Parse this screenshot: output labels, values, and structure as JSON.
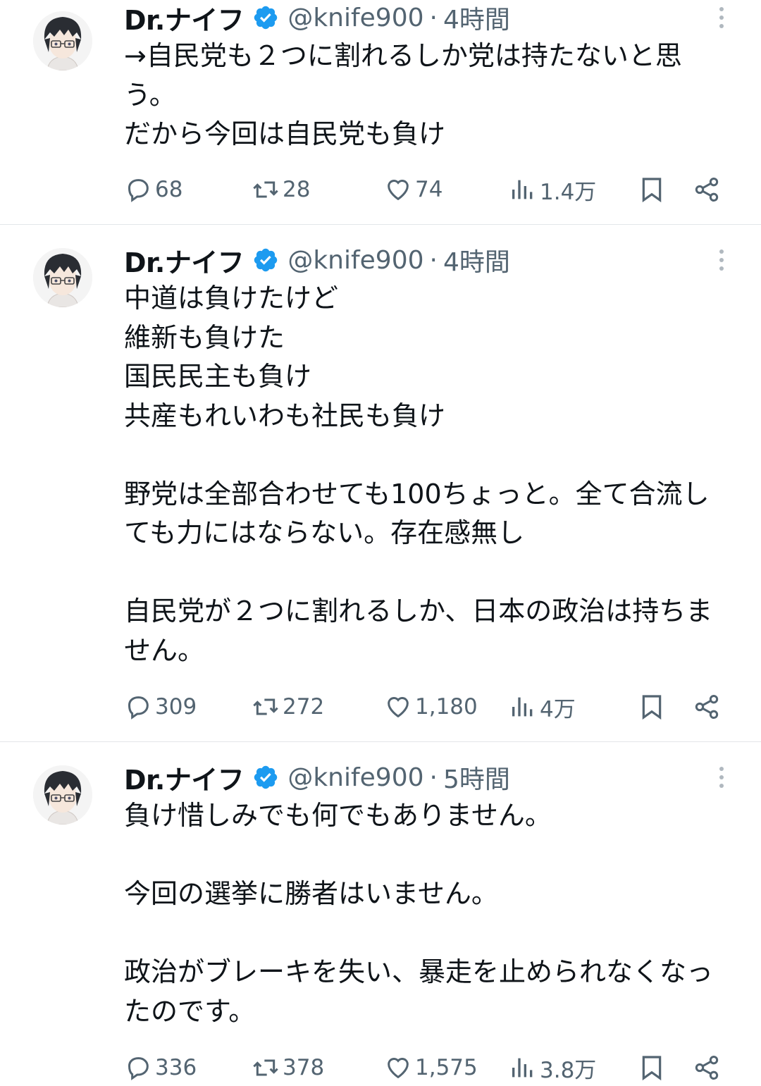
{
  "tweets": [
    {
      "author": {
        "name": "Dr.ナイフ",
        "handle": "@knife900",
        "verified": true
      },
      "time": "4時間",
      "text": "→自民党も２つに割れるしか党は持たないと思う。\nだから今回は自民党も負け",
      "stats": {
        "replies": "68",
        "reposts": "28",
        "likes": "74",
        "views": "1.4万"
      }
    },
    {
      "author": {
        "name": "Dr.ナイフ",
        "handle": "@knife900",
        "verified": true
      },
      "time": "4時間",
      "text": "中道は負けたけど\n維新も負けた\n国民民主も負け\n共産もれいわも社民も負け\n\n野党は全部合わせても100ちょっと。全て合流しても力にはならない。存在感無し\n\n自民党が２つに割れるしか、日本の政治は持ちません。",
      "stats": {
        "replies": "309",
        "reposts": "272",
        "likes": "1,180",
        "views": "4万"
      }
    },
    {
      "author": {
        "name": "Dr.ナイフ",
        "handle": "@knife900",
        "verified": true
      },
      "time": "5時間",
      "text": "負け惜しみでも何でもありません。\n\n今回の選挙に勝者はいません。\n\n政治がブレーキを失い、暴走を止められなくなったのです。",
      "stats": {
        "replies": "336",
        "reposts": "378",
        "likes": "1,575",
        "views": "3.8万"
      }
    }
  ],
  "ui": {
    "dot_separator": "·"
  },
  "colors": {
    "verified_badge": "#1d9bf0",
    "secondary_text": "#536471",
    "divider": "#e3e6e9"
  }
}
